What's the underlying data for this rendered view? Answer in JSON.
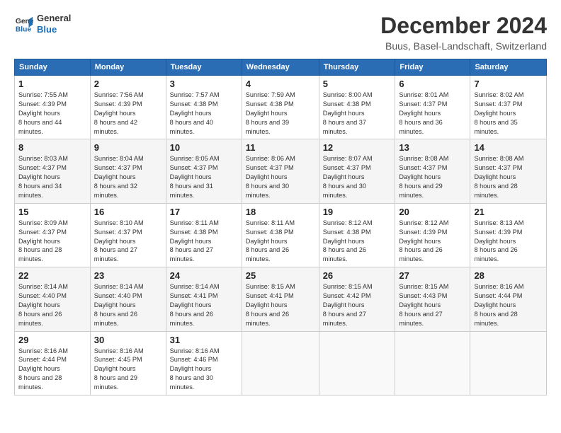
{
  "logo": {
    "line1": "General",
    "line2": "Blue"
  },
  "title": "December 2024",
  "subtitle": "Buus, Basel-Landschaft, Switzerland",
  "headers": [
    "Sunday",
    "Monday",
    "Tuesday",
    "Wednesday",
    "Thursday",
    "Friday",
    "Saturday"
  ],
  "weeks": [
    [
      {
        "day": "1",
        "sunrise": "7:55 AM",
        "sunset": "4:39 PM",
        "daylight": "8 hours and 44 minutes."
      },
      {
        "day": "2",
        "sunrise": "7:56 AM",
        "sunset": "4:39 PM",
        "daylight": "8 hours and 42 minutes."
      },
      {
        "day": "3",
        "sunrise": "7:57 AM",
        "sunset": "4:38 PM",
        "daylight": "8 hours and 40 minutes."
      },
      {
        "day": "4",
        "sunrise": "7:59 AM",
        "sunset": "4:38 PM",
        "daylight": "8 hours and 39 minutes."
      },
      {
        "day": "5",
        "sunrise": "8:00 AM",
        "sunset": "4:38 PM",
        "daylight": "8 hours and 37 minutes."
      },
      {
        "day": "6",
        "sunrise": "8:01 AM",
        "sunset": "4:37 PM",
        "daylight": "8 hours and 36 minutes."
      },
      {
        "day": "7",
        "sunrise": "8:02 AM",
        "sunset": "4:37 PM",
        "daylight": "8 hours and 35 minutes."
      }
    ],
    [
      {
        "day": "8",
        "sunrise": "8:03 AM",
        "sunset": "4:37 PM",
        "daylight": "8 hours and 34 minutes."
      },
      {
        "day": "9",
        "sunrise": "8:04 AM",
        "sunset": "4:37 PM",
        "daylight": "8 hours and 32 minutes."
      },
      {
        "day": "10",
        "sunrise": "8:05 AM",
        "sunset": "4:37 PM",
        "daylight": "8 hours and 31 minutes."
      },
      {
        "day": "11",
        "sunrise": "8:06 AM",
        "sunset": "4:37 PM",
        "daylight": "8 hours and 30 minutes."
      },
      {
        "day": "12",
        "sunrise": "8:07 AM",
        "sunset": "4:37 PM",
        "daylight": "8 hours and 30 minutes."
      },
      {
        "day": "13",
        "sunrise": "8:08 AM",
        "sunset": "4:37 PM",
        "daylight": "8 hours and 29 minutes."
      },
      {
        "day": "14",
        "sunrise": "8:08 AM",
        "sunset": "4:37 PM",
        "daylight": "8 hours and 28 minutes."
      }
    ],
    [
      {
        "day": "15",
        "sunrise": "8:09 AM",
        "sunset": "4:37 PM",
        "daylight": "8 hours and 28 minutes."
      },
      {
        "day": "16",
        "sunrise": "8:10 AM",
        "sunset": "4:37 PM",
        "daylight": "8 hours and 27 minutes."
      },
      {
        "day": "17",
        "sunrise": "8:11 AM",
        "sunset": "4:38 PM",
        "daylight": "8 hours and 27 minutes."
      },
      {
        "day": "18",
        "sunrise": "8:11 AM",
        "sunset": "4:38 PM",
        "daylight": "8 hours and 26 minutes."
      },
      {
        "day": "19",
        "sunrise": "8:12 AM",
        "sunset": "4:38 PM",
        "daylight": "8 hours and 26 minutes."
      },
      {
        "day": "20",
        "sunrise": "8:12 AM",
        "sunset": "4:39 PM",
        "daylight": "8 hours and 26 minutes."
      },
      {
        "day": "21",
        "sunrise": "8:13 AM",
        "sunset": "4:39 PM",
        "daylight": "8 hours and 26 minutes."
      }
    ],
    [
      {
        "day": "22",
        "sunrise": "8:14 AM",
        "sunset": "4:40 PM",
        "daylight": "8 hours and 26 minutes."
      },
      {
        "day": "23",
        "sunrise": "8:14 AM",
        "sunset": "4:40 PM",
        "daylight": "8 hours and 26 minutes."
      },
      {
        "day": "24",
        "sunrise": "8:14 AM",
        "sunset": "4:41 PM",
        "daylight": "8 hours and 26 minutes."
      },
      {
        "day": "25",
        "sunrise": "8:15 AM",
        "sunset": "4:41 PM",
        "daylight": "8 hours and 26 minutes."
      },
      {
        "day": "26",
        "sunrise": "8:15 AM",
        "sunset": "4:42 PM",
        "daylight": "8 hours and 27 minutes."
      },
      {
        "day": "27",
        "sunrise": "8:15 AM",
        "sunset": "4:43 PM",
        "daylight": "8 hours and 27 minutes."
      },
      {
        "day": "28",
        "sunrise": "8:16 AM",
        "sunset": "4:44 PM",
        "daylight": "8 hours and 28 minutes."
      }
    ],
    [
      {
        "day": "29",
        "sunrise": "8:16 AM",
        "sunset": "4:44 PM",
        "daylight": "8 hours and 28 minutes."
      },
      {
        "day": "30",
        "sunrise": "8:16 AM",
        "sunset": "4:45 PM",
        "daylight": "8 hours and 29 minutes."
      },
      {
        "day": "31",
        "sunrise": "8:16 AM",
        "sunset": "4:46 PM",
        "daylight": "8 hours and 30 minutes."
      },
      null,
      null,
      null,
      null
    ]
  ]
}
